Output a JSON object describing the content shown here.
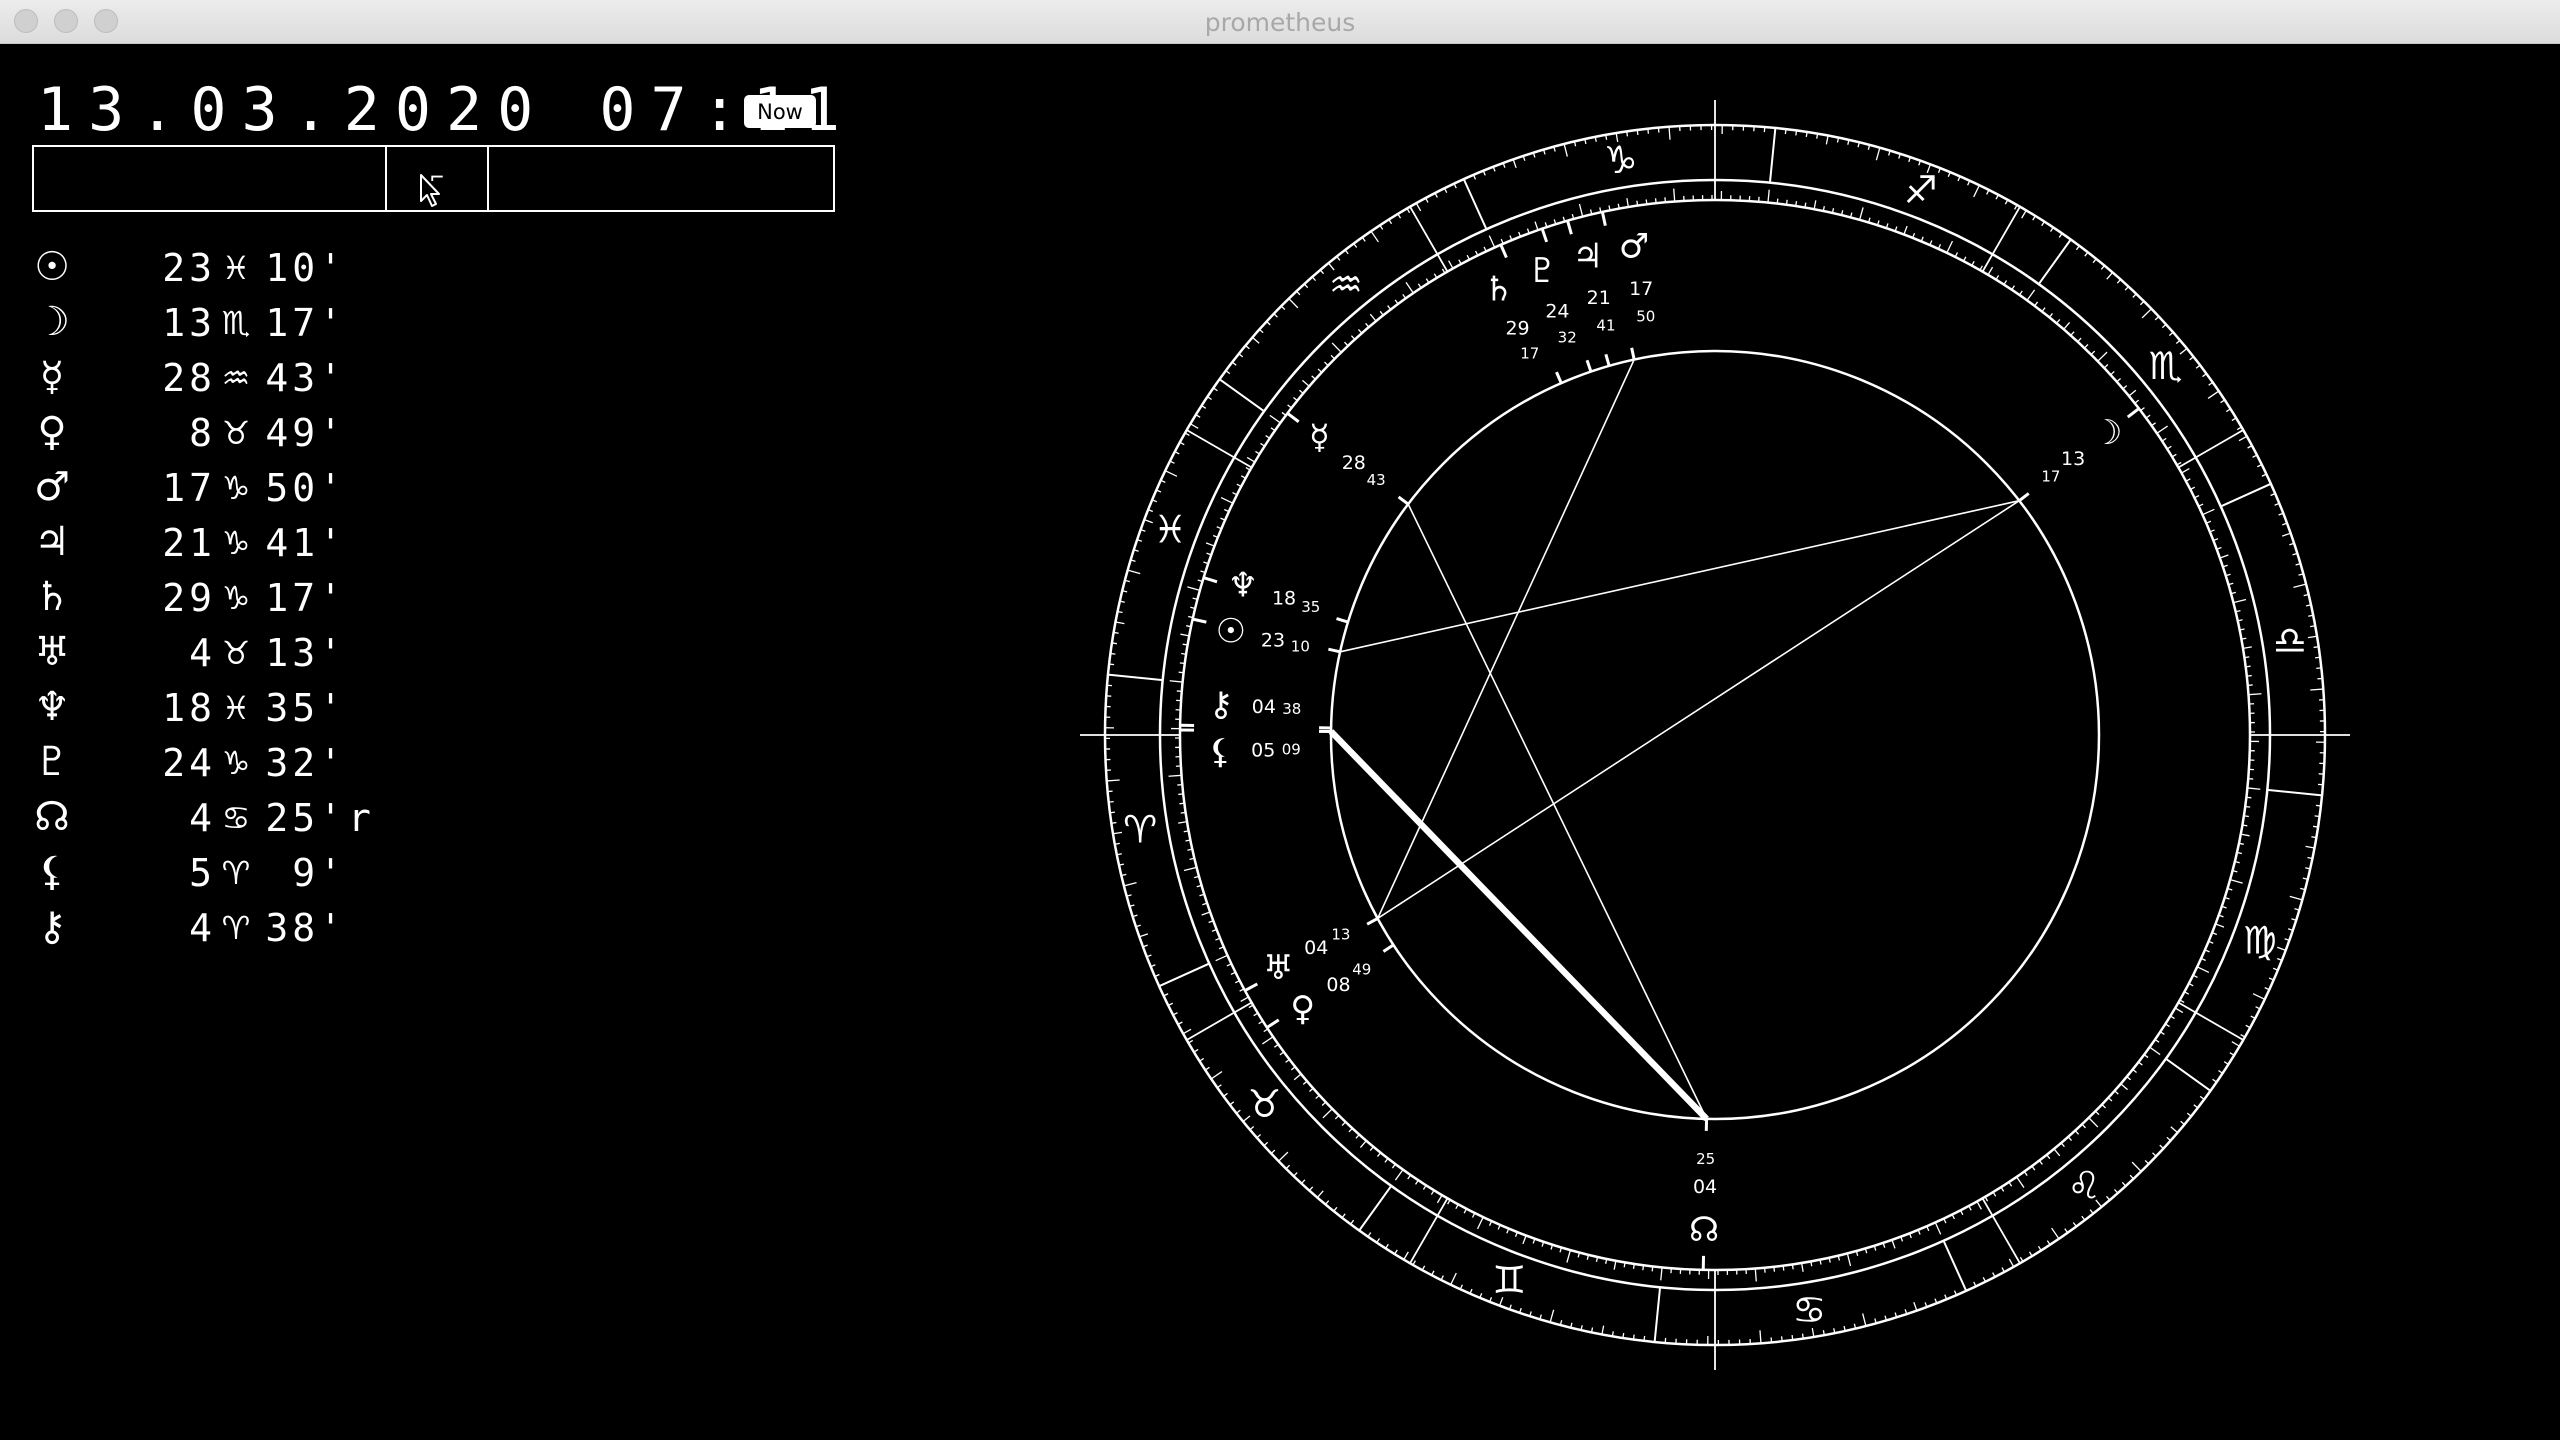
{
  "window": {
    "title": "prometheus"
  },
  "header": {
    "datetime": "13.03.2020 07:11",
    "now_label": "Now"
  },
  "inputs": {
    "left": "",
    "middle": "⌐",
    "right": ""
  },
  "planets": [
    {
      "name": "sun-glyph",
      "glyph": "☉",
      "deg": "23",
      "sign": "♓",
      "min": "10'",
      "retro": ""
    },
    {
      "name": "moon-glyph",
      "glyph": "☽",
      "deg": "13",
      "sign": "♏",
      "min": "17'",
      "retro": ""
    },
    {
      "name": "mercury-glyph",
      "glyph": "☿",
      "deg": "28",
      "sign": "♒",
      "min": "43'",
      "retro": ""
    },
    {
      "name": "venus-glyph",
      "glyph": "♀",
      "deg": "8",
      "sign": "♉",
      "min": "49'",
      "retro": ""
    },
    {
      "name": "mars-glyph",
      "glyph": "♂",
      "deg": "17",
      "sign": "♑",
      "min": "50'",
      "retro": ""
    },
    {
      "name": "jupiter-glyph",
      "glyph": "♃",
      "deg": "21",
      "sign": "♑",
      "min": "41'",
      "retro": ""
    },
    {
      "name": "saturn-glyph",
      "glyph": "♄",
      "deg": "29",
      "sign": "♑",
      "min": "17'",
      "retro": ""
    },
    {
      "name": "uranus-glyph",
      "glyph": "♅",
      "deg": "4",
      "sign": "♉",
      "min": "13'",
      "retro": ""
    },
    {
      "name": "neptune-glyph",
      "glyph": "♆",
      "deg": "18",
      "sign": "♓",
      "min": "35'",
      "retro": ""
    },
    {
      "name": "pluto-glyph",
      "glyph": "♇",
      "deg": "24",
      "sign": "♑",
      "min": "32'",
      "retro": ""
    },
    {
      "name": "node-glyph",
      "glyph": "☊",
      "deg": "4",
      "sign": "♋",
      "min": "25'",
      "retro": "r"
    },
    {
      "name": "lilith-glyph",
      "glyph": "⚸",
      "deg": "5",
      "sign": "♈",
      "min": "9'",
      "retro": ""
    },
    {
      "name": "chiron-glyph",
      "glyph": "⚷",
      "deg": "4",
      "sign": "♈",
      "min": "38'",
      "retro": ""
    }
  ],
  "wheel": {
    "ascendant_lon": 5.68,
    "signs": [
      "♈",
      "♉",
      "♊",
      "♋",
      "♌",
      "♍",
      "♎",
      "♏",
      "♐",
      "♑",
      "♒",
      "♓"
    ],
    "bodies": [
      {
        "glyph": "☉",
        "lon": 353.17,
        "d": "23",
        "m": "10"
      },
      {
        "glyph": "☽",
        "lon": 223.28,
        "d": "13",
        "m": "17"
      },
      {
        "glyph": "☿",
        "lon": 328.72,
        "d": "28",
        "m": "43"
      },
      {
        "glyph": "♀",
        "lon": 38.82,
        "d": "08",
        "m": "49"
      },
      {
        "glyph": "♂",
        "lon": 287.83,
        "d": "17",
        "m": "50"
      },
      {
        "glyph": "♃",
        "lon": 291.68,
        "d": "21",
        "m": "41"
      },
      {
        "glyph": "♄",
        "lon": 299.28,
        "d": "29",
        "m": "17"
      },
      {
        "glyph": "♅",
        "lon": 34.22,
        "d": "04",
        "m": "13"
      },
      {
        "glyph": "♆",
        "lon": 348.58,
        "d": "18",
        "m": "35"
      },
      {
        "glyph": "♇",
        "lon": 294.53,
        "d": "24",
        "m": "32"
      },
      {
        "glyph": "☊",
        "lon": 94.42,
        "d": "04",
        "m": "25"
      },
      {
        "glyph": "⚸",
        "lon": 5.15,
        "d": "05",
        "m": "09"
      },
      {
        "glyph": "⚷",
        "lon": 4.63,
        "d": "04",
        "m": "38"
      }
    ],
    "aspects": [
      [
        223.28,
        353.17,
        1
      ],
      [
        223.28,
        34.22,
        1
      ],
      [
        287.83,
        34.22,
        1
      ],
      [
        328.72,
        94.42,
        1
      ],
      [
        5.15,
        94.42,
        4
      ]
    ]
  }
}
